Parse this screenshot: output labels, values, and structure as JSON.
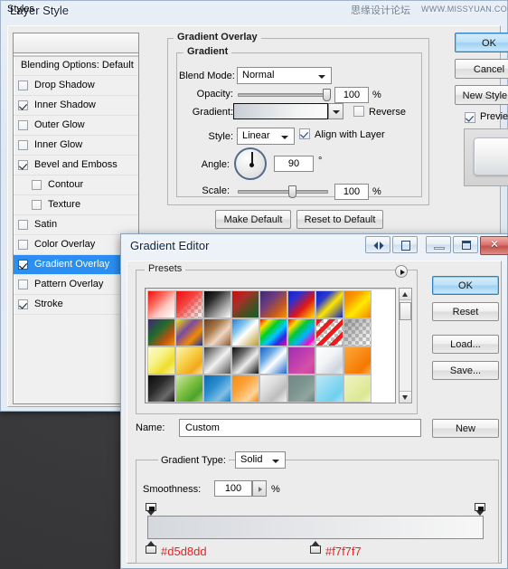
{
  "desktop": {
    "background_color": "#3a3a3c"
  },
  "watermark": {
    "cn": "思缘设计论坛",
    "url": "WWW.MISSYUAN.COM"
  },
  "layer_style": {
    "title": "Layer Style",
    "styles_panel": {
      "header": "Styles",
      "items": [
        {
          "label": "Blending Options: Default",
          "checkbox": false,
          "indent": false,
          "plain": true,
          "selected": false
        },
        {
          "label": "Drop Shadow",
          "checkbox": false,
          "indent": false,
          "plain": false,
          "selected": false
        },
        {
          "label": "Inner Shadow",
          "checkbox": true,
          "indent": false,
          "plain": false,
          "selected": false
        },
        {
          "label": "Outer Glow",
          "checkbox": false,
          "indent": false,
          "plain": false,
          "selected": false
        },
        {
          "label": "Inner Glow",
          "checkbox": false,
          "indent": false,
          "plain": false,
          "selected": false
        },
        {
          "label": "Bevel and Emboss",
          "checkbox": true,
          "indent": false,
          "plain": false,
          "selected": false
        },
        {
          "label": "Contour",
          "checkbox": false,
          "indent": true,
          "plain": false,
          "selected": false
        },
        {
          "label": "Texture",
          "checkbox": false,
          "indent": true,
          "plain": false,
          "selected": false
        },
        {
          "label": "Satin",
          "checkbox": false,
          "indent": false,
          "plain": false,
          "selected": false
        },
        {
          "label": "Color Overlay",
          "checkbox": false,
          "indent": false,
          "plain": false,
          "selected": false
        },
        {
          "label": "Gradient Overlay",
          "checkbox": true,
          "indent": false,
          "plain": false,
          "selected": true
        },
        {
          "label": "Pattern Overlay",
          "checkbox": false,
          "indent": false,
          "plain": false,
          "selected": false
        },
        {
          "label": "Stroke",
          "checkbox": true,
          "indent": false,
          "plain": false,
          "selected": false
        }
      ]
    },
    "gradient_overlay": {
      "group_title": "Gradient Overlay",
      "sub_group_title": "Gradient",
      "blend_mode_label": "Blend Mode:",
      "blend_mode_value": "Normal",
      "opacity_label": "Opacity:",
      "opacity_value": "100",
      "opacity_unit": "%",
      "gradient_label": "Gradient:",
      "reverse_label": "Reverse",
      "reverse_checked": false,
      "style_label": "Style:",
      "style_value": "Linear",
      "align_label": "Align with Layer",
      "align_checked": true,
      "angle_label": "Angle:",
      "angle_value": "90",
      "angle_unit": "°",
      "scale_label": "Scale:",
      "scale_value": "100",
      "scale_unit": "%",
      "make_default": "Make Default",
      "reset_to_default": "Reset to Default"
    },
    "buttons": {
      "ok": "OK",
      "cancel": "Cancel",
      "new_style": "New Style...",
      "preview_label": "Preview",
      "preview_checked": true
    }
  },
  "gradient_editor": {
    "title": "Gradient Editor",
    "titlebar_buttons": [
      {
        "name": "collapse-arrows",
        "glyph": "◄►"
      },
      {
        "name": "dock",
        "glyph": "▤"
      },
      {
        "name": "minimize",
        "glyph": "—"
      },
      {
        "name": "maximize",
        "glyph": "□"
      },
      {
        "name": "close",
        "glyph": "✕"
      }
    ],
    "presets": {
      "title": "Presets",
      "menu_icon": "right-triangle",
      "swatches": [
        {
          "name": "foreground-to-transparent-red",
          "css": "linear-gradient(135deg,#f20d0d 0%,#fb6a5d 35%,#fdc9c2 62%,#ffffff 100%)",
          "checker": false
        },
        {
          "name": "red-to-transparent",
          "css": "linear-gradient(135deg,#f00c0c 0%,#f4433c 40%,rgba(244,70,60,0.35) 75%,rgba(255,255,255,0) 100%)",
          "checker": true
        },
        {
          "name": "black-white",
          "css": "linear-gradient(135deg,#000000 0%,#2b2b2b 30%,#9a9a9a 65%,#ffffff 100%)",
          "checker": false
        },
        {
          "name": "red-green",
          "css": "linear-gradient(135deg,#d20b0b 0%,#a6302a 35%,#5a4a22 60%,#0f5f2a 100%)",
          "checker": false
        },
        {
          "name": "violet-orange",
          "css": "linear-gradient(135deg,#3b2a6e 0%,#6c3b80 35%,#c4591f 70%,#f79400 100%)",
          "checker": false
        },
        {
          "name": "blue-red-yellow",
          "css": "linear-gradient(135deg,#1423c8 0%,#2d2fd4 25%,#e01515 60%,#ffe000 100%)",
          "checker": false
        },
        {
          "name": "blue-yellow-blue",
          "css": "linear-gradient(135deg,#1422c6 0%,#2b3ad1 28%,#ffe600 55%,#1422c6 100%)",
          "checker": false
        },
        {
          "name": "orange-yellow-orange",
          "css": "linear-gradient(135deg,#f07c00 0%,#fa9a00 28%,#ffe900 58%,#f08700 100%)",
          "checker": false
        },
        {
          "name": "violet-green-orange",
          "css": "linear-gradient(135deg,#4a2272 0%,#1d6b2d 40%,#b8540f 72%,#f79000 100%)",
          "checker": false
        },
        {
          "name": "yellow-violet-orange-blue",
          "css": "linear-gradient(135deg,#f6e400 0%,#7a4aa0 38%,#f08a00 68%,#1b2fa8 100%)",
          "checker": false
        },
        {
          "name": "copper",
          "css": "linear-gradient(135deg,#6b3d1c 0%,#a97a4c 35%,#f0d6c3 62%,#8a5a33 100%)",
          "checker": false
        },
        {
          "name": "chrome",
          "css": "linear-gradient(135deg,#2c7fd4 0%,#7fc3ef 30%,#ffffff 52%,#c09a28 100%)",
          "checker": false
        },
        {
          "name": "spectrum",
          "css": "linear-gradient(135deg,#ff0000 0%,#ffe000 18%,#00d024 38%,#00c8ff 58%,#2a2ae0 78%,#ff00a8 100%)",
          "checker": false
        },
        {
          "name": "transparent-rainbow",
          "css": "linear-gradient(135deg,#ff0000 0%,#ffe000 20%,#00c83c 40%,#00b4ff 62%,#ff00c0 85%,rgba(255,255,255,0) 100%)",
          "checker": true
        },
        {
          "name": "transparent-stripes-red",
          "css": "repeating-linear-gradient(135deg,#ef1b1b 0px,#ef1b1b 5px,rgba(255,255,255,0) 5px,rgba(255,255,255,0) 10px)",
          "checker": true
        },
        {
          "name": "transparent-neutral",
          "css": "linear-gradient(135deg,rgba(90,90,90,0.55) 0%,rgba(140,140,140,0.3) 60%,rgba(255,255,255,0) 100%)",
          "checker": true
        },
        {
          "name": "yellow-pale",
          "css": "linear-gradient(135deg,#fbfbd0 0%,#f7f28a 40%,#eede2a 70%,#f6f3a8 100%)",
          "checker": false
        },
        {
          "name": "yellow-orange-dotted",
          "css": "linear-gradient(135deg,#fef3b5 0%,#f7cf45 45%,#f2a81b 75%,#fbe59a 100%)",
          "checker": false
        },
        {
          "name": "silver",
          "css": "linear-gradient(135deg,#3d3d3d 0%,#9f9f9f 28%,#f2f2f2 52%,#545454 100%)",
          "checker": false
        },
        {
          "name": "black-silver-black",
          "css": "linear-gradient(135deg,#0a0a0a 0%,#6e6e6e 32%,#ededed 58%,#121212 100%)",
          "checker": false
        },
        {
          "name": "blue-white-blue",
          "css": "linear-gradient(135deg,#1b63c2 0%,#69a7e4 30%,#ffffff 55%,#1e69c9 100%)",
          "checker": false
        },
        {
          "name": "magenta",
          "css": "linear-gradient(135deg,#9d2fb2 0%,#c33fae 45%,#d451a6 72%,#cf3f9e 100%)",
          "checker": false
        },
        {
          "name": "white-gray",
          "css": "linear-gradient(135deg,#ffffff 0%,#f2f4f6 45%,#cdd4dc 80%,#e6eaee 100%)",
          "checker": false
        },
        {
          "name": "orange-dotted",
          "css": "linear-gradient(135deg,#fca63a 0%,#f98b16 45%,#f57800 75%,#fbae4a 100%)",
          "checker": false
        },
        {
          "name": "black-gray",
          "css": "linear-gradient(135deg,#0b0b0b 0%,#2c2c2c 40%,#6a6a6a 72%,#1a1a1a 100%)",
          "checker": false
        },
        {
          "name": "green-speckle",
          "css": "linear-gradient(135deg,#cfe8a8 0%,#7ec143 45%,#4fa32a 75%,#9fd06a 100%)",
          "checker": false
        },
        {
          "name": "blue-steel",
          "css": "linear-gradient(135deg,#0a6ab0 0%,#2b8ed0 40%,#7fc0e6 72%,#1b7ec2 100%)",
          "checker": false
        },
        {
          "name": "orange-white",
          "css": "linear-gradient(135deg,#f98a12 0%,#fba33a 40%,#fdd49a 75%,#f4870c 100%)",
          "checker": false
        },
        {
          "name": "light-silver",
          "css": "linear-gradient(135deg,#f4f4f4 0%,#dcdcdc 40%,#bdbdbd 70%,#f2f2f2 100%)",
          "checker": false
        },
        {
          "name": "slate-green",
          "css": "linear-gradient(135deg,#6f8a85 0%,#7e948f 45%,#8fa6a0 75%,#69837e 100%)",
          "checker": false
        },
        {
          "name": "light-blue",
          "css": "linear-gradient(135deg,#bde8f7 0%,#8fd9f2 45%,#6fd0ee 75%,#a7e2f5 100%)",
          "checker": false
        },
        {
          "name": "pale-yellow-green",
          "css": "linear-gradient(135deg,#eef3c2 0%,#e4eda7 45%,#dbe792 75%,#f0f4cc 100%)",
          "checker": false
        }
      ]
    },
    "name_label": "Name:",
    "name_value": "Custom",
    "new_button": "New",
    "gradient_type_label": "Gradient Type:",
    "gradient_type_value": "Solid",
    "smoothness_label": "Smoothness:",
    "smoothness_value": "100",
    "smoothness_unit": "%",
    "gradient_bar": {
      "left_color": "#d5d8dd",
      "right_color": "#f7f7f7",
      "left_hex_label": "#d5d8dd",
      "right_hex_label": "#f7f7f7",
      "opacity_stops": 2,
      "color_stops": 2
    },
    "buttons": {
      "ok": "OK",
      "reset": "Reset",
      "load": "Load...",
      "save": "Save..."
    }
  }
}
